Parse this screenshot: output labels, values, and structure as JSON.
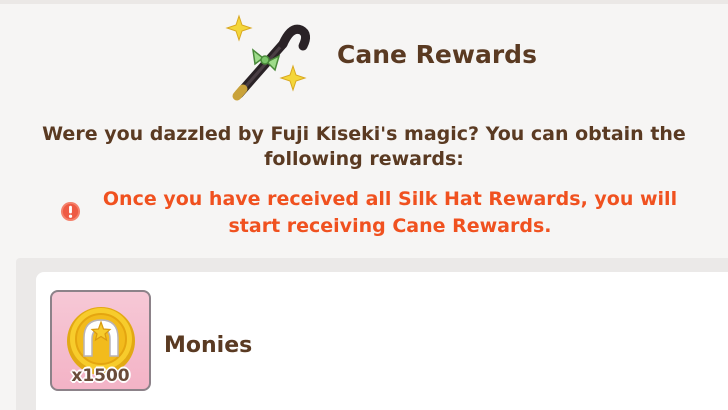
{
  "header": {
    "title": "Cane Rewards",
    "icon": "cane-icon"
  },
  "description": "Were you dazzled by Fuji Kiseki's magic? You can obtain the following rewards:",
  "notice": {
    "icon": "warning-icon",
    "text": "Once you have received all Silk Hat Rewards, you will start receiving Cane Rewards."
  },
  "rewards": [
    {
      "name": "Monies",
      "quantity": "x1500",
      "icon": "horseshoe-coin-icon"
    }
  ],
  "colors": {
    "title": "#5a3a22",
    "notice": "#f0511f",
    "thumb_bg": "#f6c8d6"
  }
}
